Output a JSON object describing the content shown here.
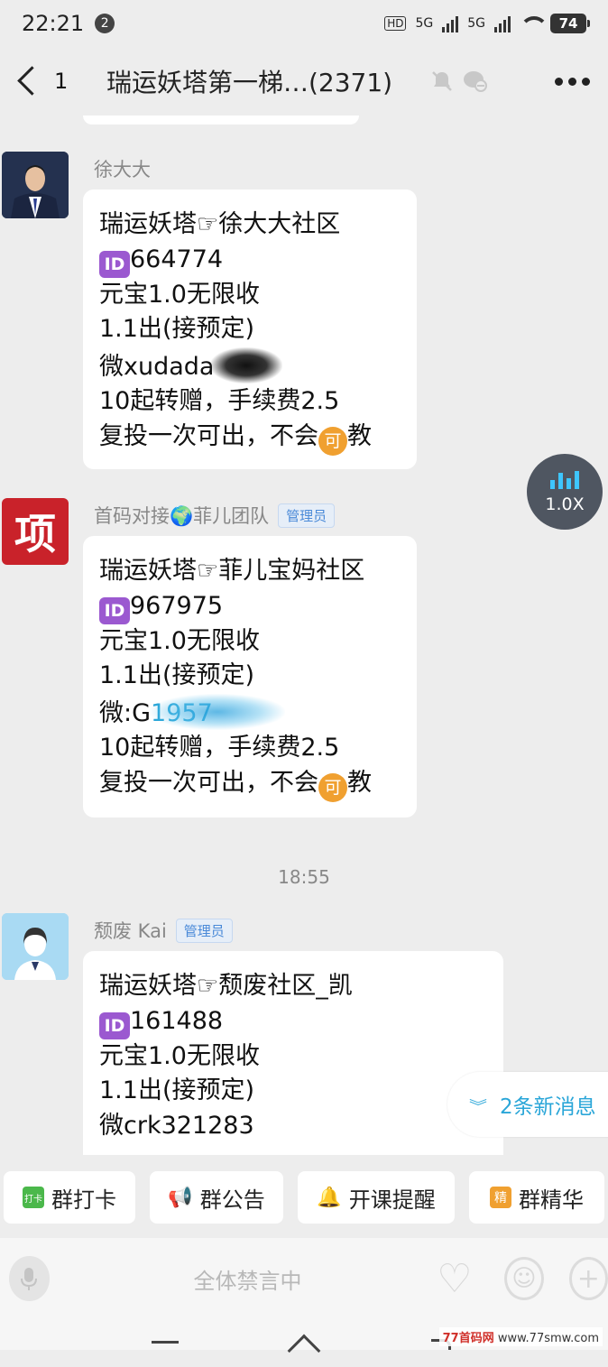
{
  "status_bar": {
    "time": "22:21",
    "notification_count": "2",
    "signal_label_1": "HD",
    "signal_label_2": "5G",
    "signal_label_3": "5G",
    "battery": "74"
  },
  "header": {
    "unread_count": "1",
    "title": "瑞运妖塔第一梯…(2371)"
  },
  "messages": [
    {
      "sender": "徐大大",
      "role": "",
      "lines": [
        "瑞运妖塔☞徐大大社区",
        "664774",
        "元宝1.0无限收",
        "1.1出(接预定)",
        "微xudada",
        "10起转赠，手续费2.5",
        "复投一次可出，不会",
        "教"
      ]
    },
    {
      "sender": "首码对接🌍菲儿团队",
      "role": "管理员",
      "avatar_char": "项",
      "lines": [
        "瑞运妖塔☞菲儿宝妈社区",
        "967975",
        "元宝1.0无限收",
        "1.1出(接预定)",
        "微:G",
        "1957",
        "10起转赠，手续费2.5",
        "复投一次可出，不会",
        "教"
      ]
    },
    {
      "sender": "颓废 Kai",
      "role": "管理员",
      "lines": [
        "瑞运妖塔☞颓废社区_凯",
        "161488",
        "元宝1.0无限收",
        "1.1出(接预定)",
        "微crk321283"
      ]
    }
  ],
  "icons": {
    "id_mark": "ID",
    "ke_mark": "可"
  },
  "timestamp": "18:55",
  "speed_button": "1.0X",
  "new_messages": "2条新消息",
  "quick_actions": [
    "群打卡",
    "群公告",
    "开课提醒",
    "群精华"
  ],
  "quick_icon_labels": {
    "checkin": "打卡",
    "essence": "精"
  },
  "input_bar": {
    "muted_text": "全体禁言中"
  },
  "watermark": {
    "brand": "77首码网",
    "url": "www.77smw.com"
  },
  "colors": {
    "background": "#ededed",
    "bubble": "#ffffff",
    "accent_blue": "#2aa6d8",
    "admin_badge": "#4a8ad8",
    "id_purple": "#9b59d0",
    "ke_orange": "#f0a030"
  }
}
